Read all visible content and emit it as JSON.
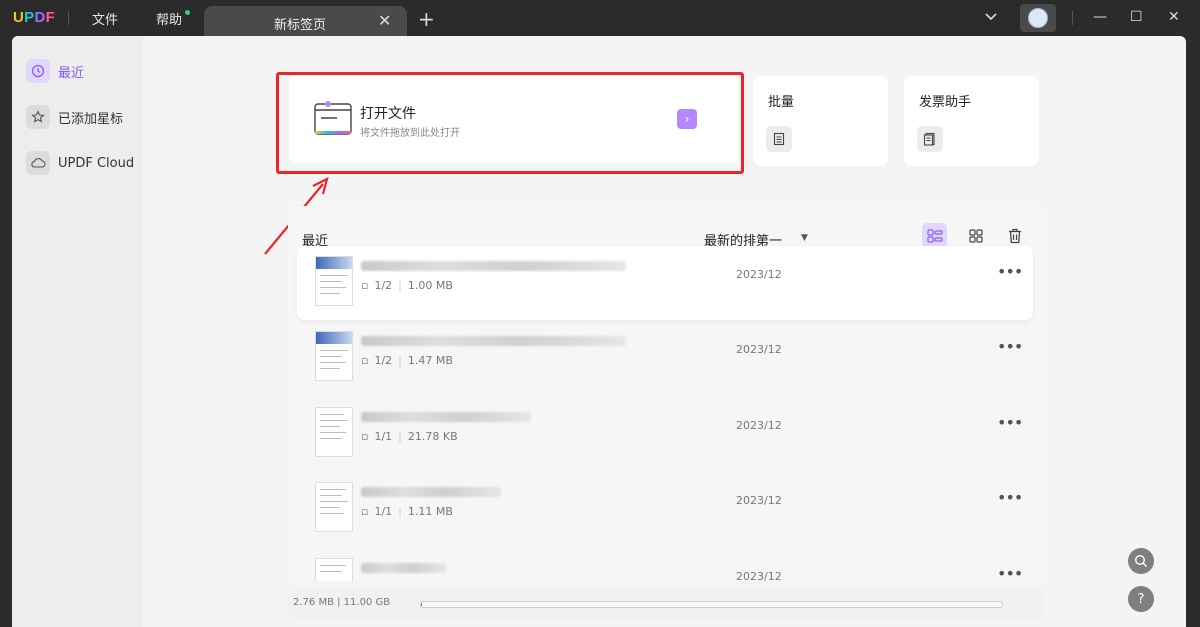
{
  "titlebar": {
    "logo": {
      "u": "U",
      "p": "P",
      "d": "D",
      "f": "F"
    },
    "menu_file": "文件",
    "menu_help": "帮助",
    "tab_label": "新标签页",
    "tab_close": "✕",
    "tab_add": "+",
    "minimize": "—",
    "maximize": "☐",
    "close": "✕"
  },
  "sidebar": {
    "items": [
      {
        "label": "最近",
        "icon": "clock-icon",
        "active": true
      },
      {
        "label": "已添加星标",
        "icon": "star-icon",
        "active": false
      },
      {
        "label": "UPDF Cloud",
        "icon": "cloud-icon",
        "active": false
      }
    ]
  },
  "open_file": {
    "title": "打开文件",
    "subtitle": "将文件拖放到此处打开",
    "button": "›"
  },
  "tools": [
    {
      "label": "批量",
      "icon": "batch-icon"
    },
    {
      "label": "发票助手",
      "icon": "invoice-icon"
    }
  ],
  "recent": {
    "title": "最近",
    "sort_label": "最新的排第一",
    "sort_arrow": "▼",
    "files": [
      {
        "pages": "1/2",
        "size": "1.00 MB",
        "date": "2023/12"
      },
      {
        "pages": "1/2",
        "size": "1.47 MB",
        "date": "2023/12"
      },
      {
        "pages": "1/1",
        "size": "21.78 KB",
        "date": "2023/12"
      },
      {
        "pages": "1/1",
        "size": "1.11 MB",
        "date": "2023/12"
      },
      {
        "pages": "",
        "size": "",
        "date": "2023/12"
      }
    ],
    "more": "•••"
  },
  "storage": {
    "text": "2.76 MB | 11.00 GB",
    "used_fraction": 0.0003
  },
  "floating": {
    "help": "?"
  },
  "colors": {
    "accent": "#8a5cf5",
    "highlight": "#e8272b"
  }
}
